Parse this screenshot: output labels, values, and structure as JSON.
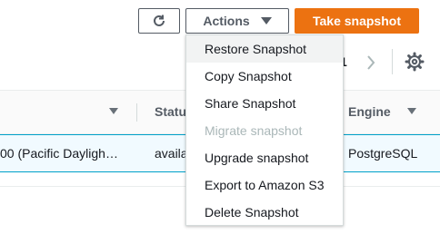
{
  "toolbar": {
    "refresh_icon": "refresh-icon",
    "actions_label": "Actions",
    "take_snapshot_label": "Take snapshot"
  },
  "pagination": {
    "current_page": "1"
  },
  "table": {
    "headers": [
      "Statu",
      "Engine"
    ],
    "row": {
      "time": "00 (Pacific Dayligh…",
      "status": "availa",
      "engine": "PostgreSQL"
    }
  },
  "actions_menu": {
    "items": [
      {
        "label": "Restore Snapshot",
        "state": "hover"
      },
      {
        "label": "Copy Snapshot",
        "state": "normal"
      },
      {
        "label": "Share Snapshot",
        "state": "normal"
      },
      {
        "label": "Migrate snapshot",
        "state": "disabled"
      },
      {
        "label": "Upgrade snapshot",
        "state": "normal"
      },
      {
        "label": "Export to Amazon S3",
        "state": "normal"
      },
      {
        "label": "Delete Snapshot",
        "state": "normal"
      }
    ]
  },
  "colors": {
    "primary_button": "#ec7211",
    "selected_row_bg": "#f1faff",
    "selected_row_border": "#00a1c9",
    "disabled_text": "#aab7b8"
  }
}
